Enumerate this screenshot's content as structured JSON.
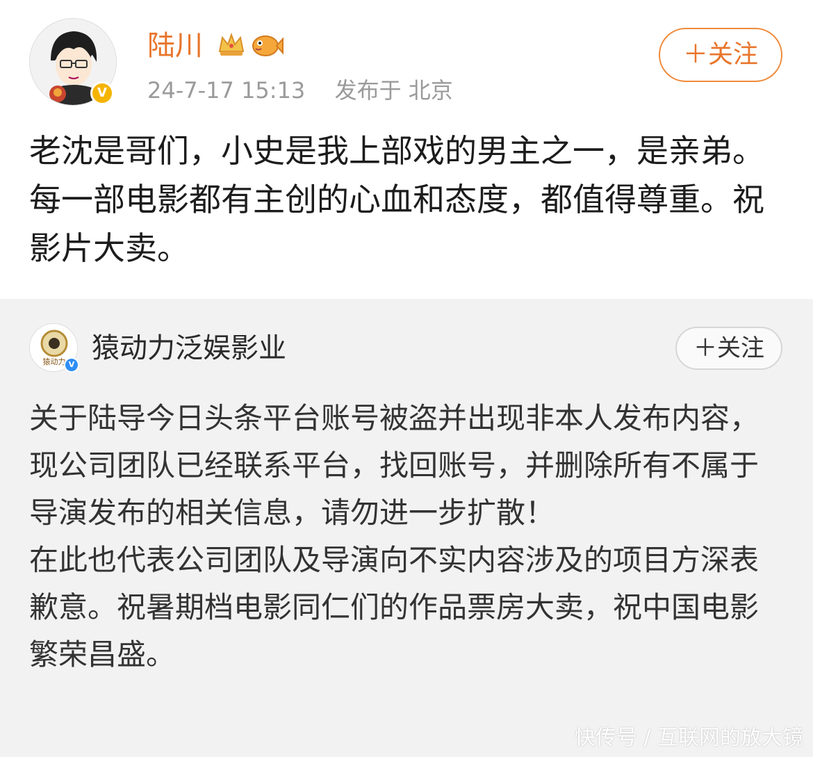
{
  "post1": {
    "author": "陆川",
    "timestamp": "24-7-17 15:13",
    "published_in": "发布于 北京",
    "follow_label": "＋关注",
    "text": "老沈是哥们，小史是我上部戏的男主之一，是亲弟。每一部电影都有主创的心血和态度，都值得尊重。祝影片大卖。",
    "badge_icon": "gold-verified-icon",
    "badges": [
      "crown-icon",
      "fish-icon"
    ]
  },
  "post2": {
    "author": "猿动力泛娱影业",
    "follow_label": "＋关注",
    "paragraphs": [
      "关于陆导今日头条平台账号被盗并出现非本人发布内容，现公司团队已经联系平台，找回账号，并删除所有不属于导演发布的相关信息，请勿进一步扩散！",
      "在此也代表公司团队及导演向不实内容涉及的项目方深表歉意。祝暑期档电影同仁们的作品票房大卖，祝中国电影繁荣昌盛。"
    ],
    "avatar_text": "猿动力",
    "badge_icon": "blue-verified-icon"
  },
  "watermark": "快传号 / 互联网的放大镜",
  "colors": {
    "author_orange": "#e8752b",
    "follow_border": "#f08a3a",
    "meta_gray": "#9a9a9a",
    "repost_bg": "#f2f2f2"
  }
}
